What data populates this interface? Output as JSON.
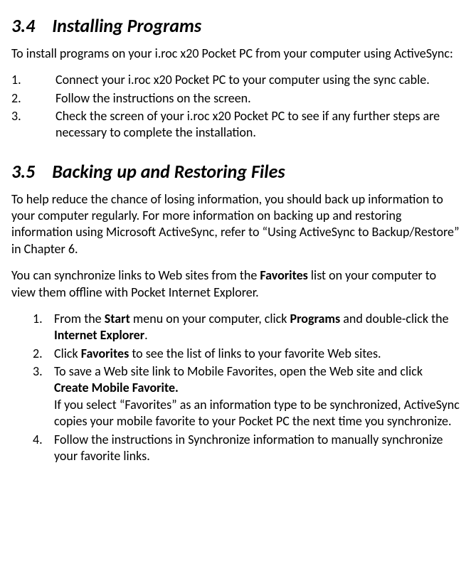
{
  "sec34": {
    "num": "3.4",
    "title": "Installing Programs",
    "intro": "To install programs on your i.roc x20 Pocket PC from your computer using ActiveSync:",
    "steps": [
      {
        "n": "1.",
        "t": "Connect your i.roc x20 Pocket PC to your computer using the sync cable."
      },
      {
        "n": "2.",
        "t": "Follow the instructions on the screen."
      },
      {
        "n": "3.",
        "t": "Check the screen of your i.roc x20 Pocket PC to see if any further steps are necessary to complete the installation."
      }
    ]
  },
  "sec35": {
    "num": "3.5",
    "title": "Backing up and Restoring Files",
    "p1": "To help reduce the chance of losing information, you should back up information to your computer regularly. For more information on backing up and restoring information using Microsoft ActiveSync, refer to “Using ActiveSync to Backup/Restore” in Chapter 6.",
    "p2_a": "You can synchronize links to Web sites from the ",
    "p2_b_bold": "Favorites",
    "p2_c": " list on your computer to view them offline with Pocket Internet Explorer.",
    "steps": [
      {
        "n": "1.",
        "parts": [
          {
            "t": "From the "
          },
          {
            "t": "Start",
            "bold": true
          },
          {
            "t": " menu on your computer, click "
          },
          {
            "t": "Programs",
            "bold": true
          },
          {
            "t": " and double-click the "
          },
          {
            "t": "Internet Explorer",
            "bold": true
          },
          {
            "t": "."
          }
        ]
      },
      {
        "n": "2.",
        "parts": [
          {
            "t": "Click "
          },
          {
            "t": "Favorites",
            "bold": true
          },
          {
            "t": " to see the list of links to your favorite Web sites."
          }
        ]
      },
      {
        "n": "3.",
        "parts": [
          {
            "t": "To save a Web site link to Mobile Favorites, open the Web site and click "
          },
          {
            "t": "Create Mobile Favorite.",
            "bold": true
          },
          {
            "t": "\nIf you select “Favorites” as an information type to be synchronized, ActiveSync copies your mobile favorite to your Pocket PC the next time you synchronize."
          }
        ]
      },
      {
        "n": "4.",
        "parts": [
          {
            "t": "Follow the instructions in Synchronize information to manually synchronize your favorite links."
          }
        ]
      }
    ]
  }
}
